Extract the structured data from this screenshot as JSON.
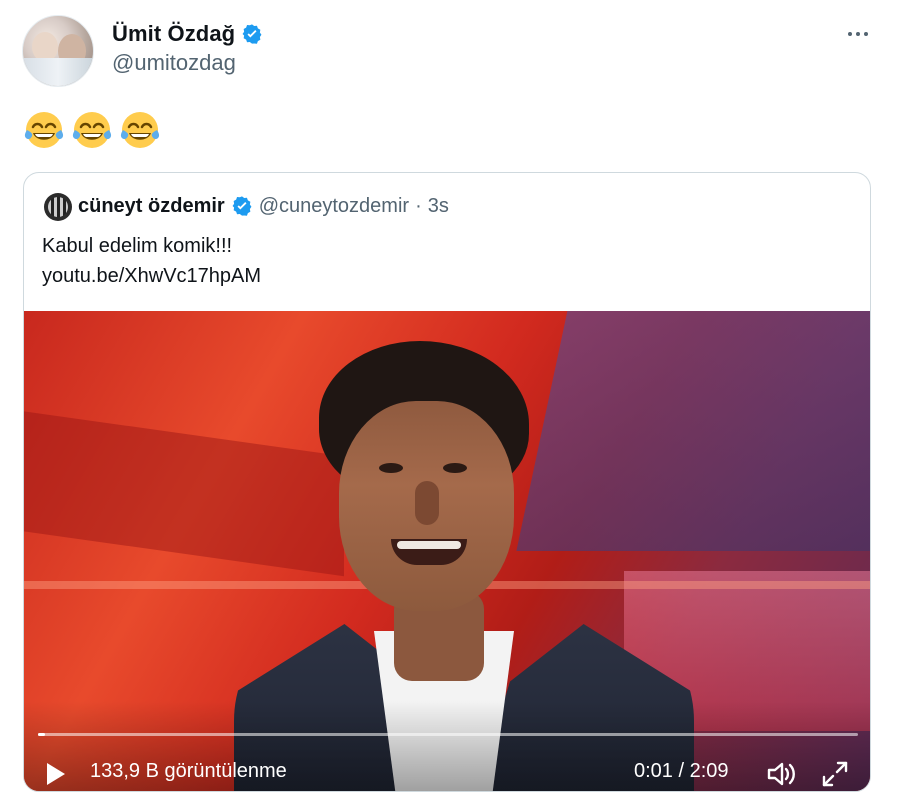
{
  "tweet": {
    "author": {
      "display_name": "Ümit Özdağ",
      "handle": "@umitozdag",
      "verified": true
    },
    "text_emojis": [
      "😂",
      "😂",
      "😂"
    ],
    "more_icon": "more-horizontal-icon"
  },
  "quoted_tweet": {
    "author": {
      "display_name": "cüneyt özdemir",
      "handle": "@cuneytozdemir",
      "verified": true
    },
    "separator": "·",
    "time": "3s",
    "text": "Kabul edelim komik!!!",
    "link": "youtu.be/XhwVc17hpAM",
    "video": {
      "views_text": "133,9 B görüntülenme",
      "current_time": "0:01",
      "duration": "2:09",
      "time_display": "0:01 / 2:09",
      "progress": 0.008,
      "play_icon": "play-icon",
      "volume_icon": "volume-icon",
      "fullscreen_icon": "fullscreen-icon"
    }
  },
  "colors": {
    "text_primary": "#0f1419",
    "text_secondary": "#536471",
    "border": "#cfd9de",
    "verified_blue": "#1d9bf0"
  }
}
